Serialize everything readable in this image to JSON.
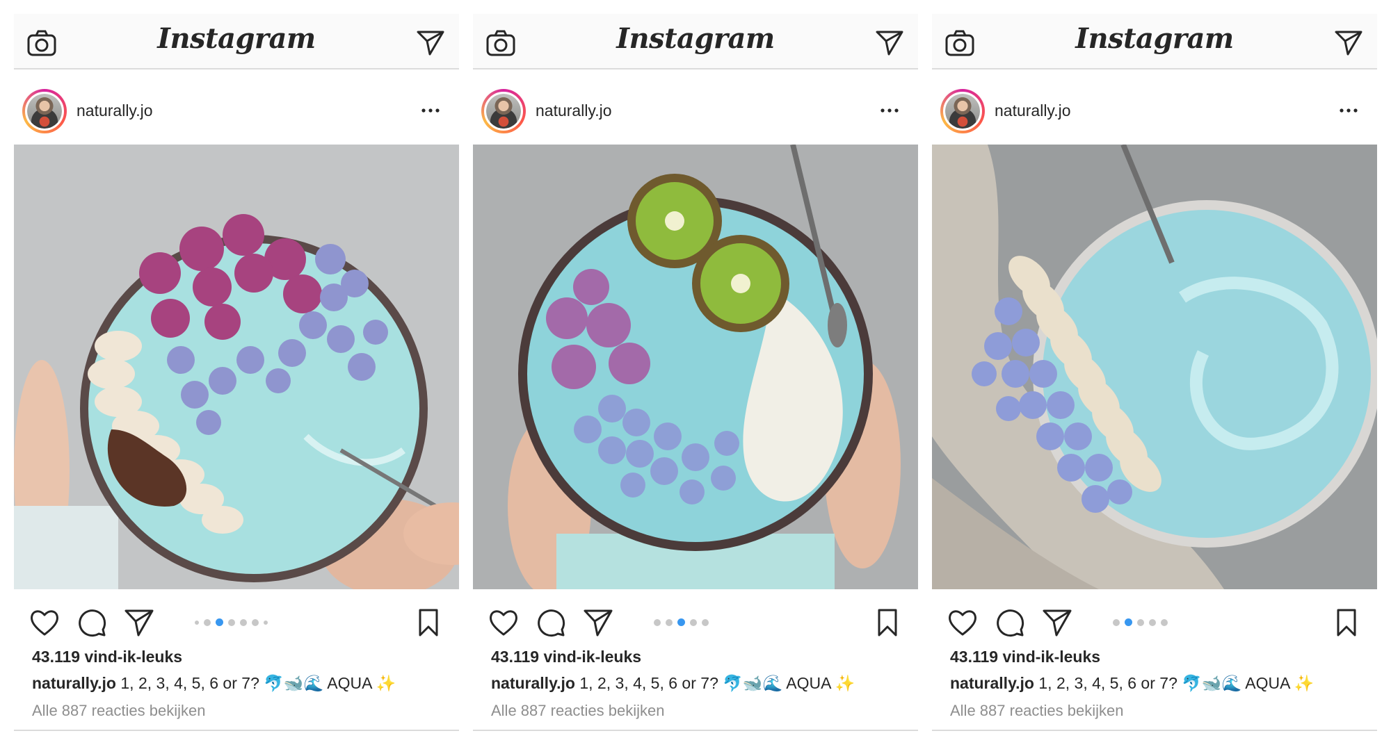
{
  "app": {
    "logo_text": "Instagram"
  },
  "colors": {
    "accent": "#3897f0",
    "text": "#262626",
    "muted": "#8e8e8e",
    "border": "#dbdbdb"
  },
  "icons": [
    "camera-icon",
    "direct-send-icon",
    "more-options-icon",
    "heart-icon",
    "comment-icon",
    "share-icon",
    "bookmark-icon"
  ],
  "posts": [
    {
      "username": "naturally.jo",
      "likes": "43.119 vind-ik-leuks",
      "caption_user": "naturally.jo",
      "caption_text": " 1, 2, 3, 4, 5, 6 or 7? 🐬🐋🌊 AQUA ✨",
      "view_comments": "Alle 887 reacties bekijken",
      "carousel": {
        "count": 7,
        "active": 2
      }
    },
    {
      "username": "naturally.jo",
      "likes": "43.119 vind-ik-leuks",
      "caption_user": "naturally.jo",
      "caption_text": " 1, 2, 3, 4, 5, 6 or 7? 🐬🐋🌊 AQUA ✨",
      "view_comments": "Alle 887 reacties bekijken",
      "carousel": {
        "count": 5,
        "active": 2
      }
    },
    {
      "username": "naturally.jo",
      "likes": "43.119 vind-ik-leuks",
      "caption_user": "naturally.jo",
      "caption_text": " 1, 2, 3, 4, 5, 6 or 7? 🐬🐋🌊 AQUA ✨",
      "view_comments": "Alle 887 reacties bekijken",
      "carousel": {
        "count": 5,
        "active": 1
      }
    }
  ]
}
